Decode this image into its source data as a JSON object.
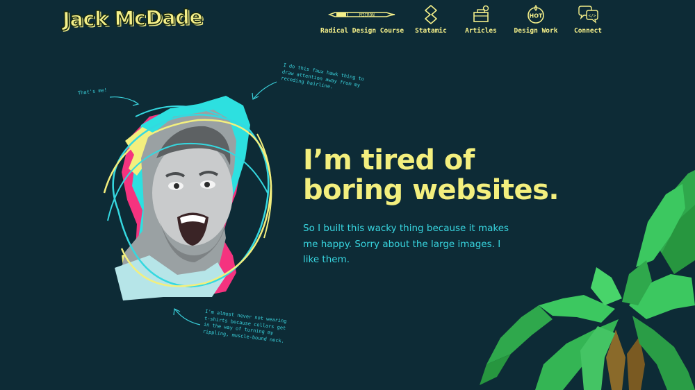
{
  "site": {
    "logo_text": "Jack McDade"
  },
  "nav": {
    "items": [
      {
        "label": "Radical Design Course",
        "icon": "micron-pen-icon"
      },
      {
        "label": "Statamic",
        "icon": "statamic-logo-icon"
      },
      {
        "label": "Articles",
        "icon": "toolbox-icon"
      },
      {
        "label": "Design Work",
        "icon": "hot-badge-icon"
      },
      {
        "label": "Connect",
        "icon": "chat-bubbles-icon"
      }
    ],
    "pen_label": "MICRON"
  },
  "hero": {
    "headline_line1": "I’m tired of",
    "headline_line2": "boring websites.",
    "subtext": "So I built this wacky thing because it makes me happy. Sorry about the large images. I like them."
  },
  "annotations": {
    "thats_me": "That's me!",
    "fauxhawk": "I do this faux hawk thing to draw attention away from my receding hairline.",
    "tshirt": "I'm almost never not wearing t-shirts because collars get in the way of turning my rippling, muscle-bound neck."
  },
  "colors": {
    "background": "#0d2b36",
    "yellow": "#f3ef7e",
    "cyan": "#38d6e0",
    "pink": "#f5337f",
    "leaf_green": "#3cc860"
  }
}
